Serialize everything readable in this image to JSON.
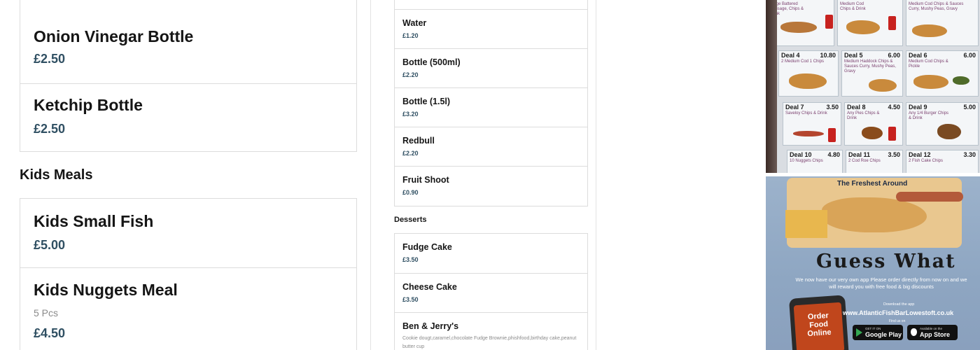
{
  "left_menu": {
    "top_card_items": [
      {
        "name": "Onion Vinegar Bottle",
        "price": "£2.50"
      },
      {
        "name": "Ketchip Bottle",
        "price": "£2.50"
      }
    ],
    "kids_section": {
      "title": "Kids Meals",
      "items": [
        {
          "name": "Kids Small Fish",
          "price": "£5.00"
        },
        {
          "name": "Kids Nuggets Meal",
          "description": "5 Pcs",
          "price": "£4.50"
        }
      ]
    }
  },
  "middle_menu": {
    "drinks_items": [
      {
        "name": "Water",
        "price": "£1.20"
      },
      {
        "name": "Bottle (500ml)",
        "price": "£2.20"
      },
      {
        "name": "Bottle (1.5l)",
        "price": "£3.20"
      },
      {
        "name": "Redbull",
        "price": "£2.20"
      },
      {
        "name": "Fruit Shoot",
        "price": "£0.90"
      }
    ],
    "desserts_section": {
      "title": "Desserts",
      "items": [
        {
          "name": "Fudge Cake",
          "price": "£3.50"
        },
        {
          "name": "Cheese Cake",
          "price": "£3.50"
        },
        {
          "name": "Ben & Jerry's",
          "description": "Cookie dougt,caramel,chocolate Fudge Brownie,phishfood,birthday cake,peanut butter cup"
        }
      ]
    }
  },
  "photos": {
    "deals_board": {
      "top_row": [
        {
          "desc": "Large Battered Sausage, Chips & Drink"
        },
        {
          "desc": "Medium Cod Chips & Drink"
        },
        {
          "desc": "Medium Cod Chips & Sauces Curry, Mushy Peas, Gravy"
        }
      ],
      "deals": [
        {
          "title": "Deal 4",
          "price": "10.80",
          "desc": "2 Medium Cod 1 Chips"
        },
        {
          "title": "Deal 5",
          "price": "6.00",
          "desc": "Medium Haddock Chips & Sauces Curry, Mushy Peas, Gravy"
        },
        {
          "title": "Deal 6",
          "price": "6.00",
          "desc": "Medium Cod Chips & Pickle"
        },
        {
          "title": "Deal 7",
          "price": "3.50",
          "desc": "Saveloy Chips & Drink"
        },
        {
          "title": "Deal 8",
          "price": "4.50",
          "desc": "Any Pies Chips & Drink"
        },
        {
          "title": "Deal 9",
          "price": "5.00",
          "desc": "Any 1/4 Burger Chips & Drink"
        },
        {
          "title": "Deal 10",
          "price": "4.80",
          "desc": "10 Nuggets Chips"
        },
        {
          "title": "Deal 11",
          "price": "3.50",
          "desc": "2 Cod Roe Chips"
        },
        {
          "title": "Deal 12",
          "price": "3.30",
          "desc": "2 Fish Cake Chips"
        }
      ]
    },
    "flyer": {
      "headline_top": "The Freshest Around",
      "headline": "Guess What",
      "body": "We now have our very own app Please order directly from now on and we will reward you with free food & big discounts",
      "download_label": "Download the app",
      "url": "www.AtlanticFishBarLowestoft.co.uk",
      "find_label": "Find us on",
      "phone_label": "Order Food Online",
      "google_play_small": "GET IT ON",
      "google_play": "Google Play",
      "app_store_small": "Available on the",
      "app_store": "App Store"
    }
  },
  "colors": {
    "price_text": "#2f4f62",
    "card_border": "#dcdcdc",
    "desc_text": "#8a8a8a"
  }
}
